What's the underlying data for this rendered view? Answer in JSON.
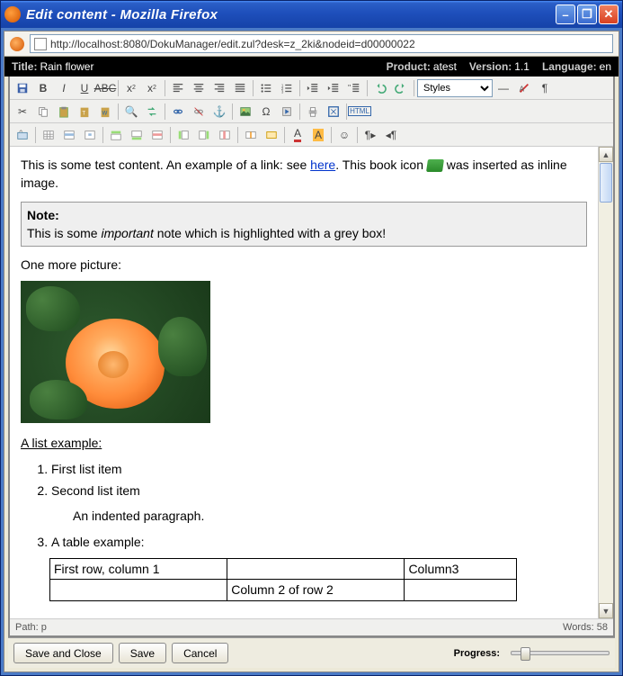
{
  "window": {
    "title": "Edit content - Mozilla Firefox"
  },
  "address": {
    "url": "http://localhost:8080/DokuManager/edit.zul?desk=z_2ki&nodeid=d00000022"
  },
  "header": {
    "title_label": "Title:",
    "title_value": "Rain flower",
    "product_label": "Product:",
    "product_value": "atest",
    "version_label": "Version:",
    "version_value": "1.1",
    "language_label": "Language:",
    "language_value": "en"
  },
  "toolbar": {
    "styles_label": "Styles"
  },
  "content": {
    "intro_a": "This is some test content. An example of a link: see ",
    "link_text": "here",
    "intro_b": ". This book icon ",
    "intro_c": " was inserted as inline image.",
    "note_title": "Note:",
    "note_a": "This is some ",
    "note_em": "important",
    "note_b": " note which is highlighted with a grey box!",
    "pic_caption": "One more picture:",
    "list_heading": "A list example:",
    "li1": "First list item",
    "li2": "Second list item",
    "indent": "An indented paragraph.",
    "li3": "A table example:",
    "table": {
      "r1c1": "First row, column 1",
      "r1c2": "",
      "r1c3": "Column3",
      "r2c1": "",
      "r2c2": "Column 2 of row 2",
      "r2c3": ""
    }
  },
  "status": {
    "path_label": "Path:",
    "path_value": "p",
    "words_label": "Words:",
    "words_value": "58"
  },
  "footer": {
    "save_close": "Save and Close",
    "save": "Save",
    "cancel": "Cancel",
    "progress": "Progress:"
  }
}
